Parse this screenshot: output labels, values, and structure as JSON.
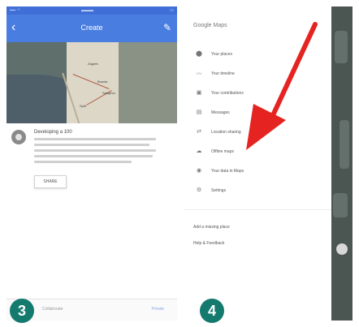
{
  "left_screen": {
    "app_bar": {
      "title": "Create"
    },
    "map_labels": [
      "Zagreb",
      "Bosnia",
      "Sarajevo",
      "Split"
    ],
    "info": {
      "heading": "Developing a 100",
      "share_label": "SHARE"
    },
    "bottom_bar": {
      "label": "Collaborate",
      "button_label": "Private"
    },
    "step_badge": "3"
  },
  "right_screen": {
    "drawer": {
      "brand": "Google Maps",
      "items": [
        {
          "icon": "location-pin-icon",
          "glyph": "⬤",
          "label": "Your places"
        },
        {
          "icon": "timeline-icon",
          "glyph": "〰",
          "label": "Your timeline"
        },
        {
          "icon": "contributions-icon",
          "glyph": "▣",
          "label": "Your contributions"
        },
        {
          "icon": "messages-icon",
          "glyph": "▤",
          "label": "Messages"
        },
        {
          "icon": "location-sharing-icon",
          "glyph": "⇄",
          "label": "Location sharing"
        },
        {
          "icon": "offline-maps-icon",
          "glyph": "☁",
          "label": "Offline maps"
        },
        {
          "icon": "data-icon",
          "glyph": "◉",
          "label": "Your data in Maps"
        },
        {
          "icon": "settings-icon",
          "glyph": "⚙",
          "label": "Settings"
        }
      ],
      "footer_items": [
        "Add a missing place",
        "Help & Feedback"
      ]
    },
    "step_badge": "4"
  },
  "accent_colors": {
    "app_bar": "#4a7de0",
    "badge": "#157a6e",
    "arrow": "#e52421"
  }
}
